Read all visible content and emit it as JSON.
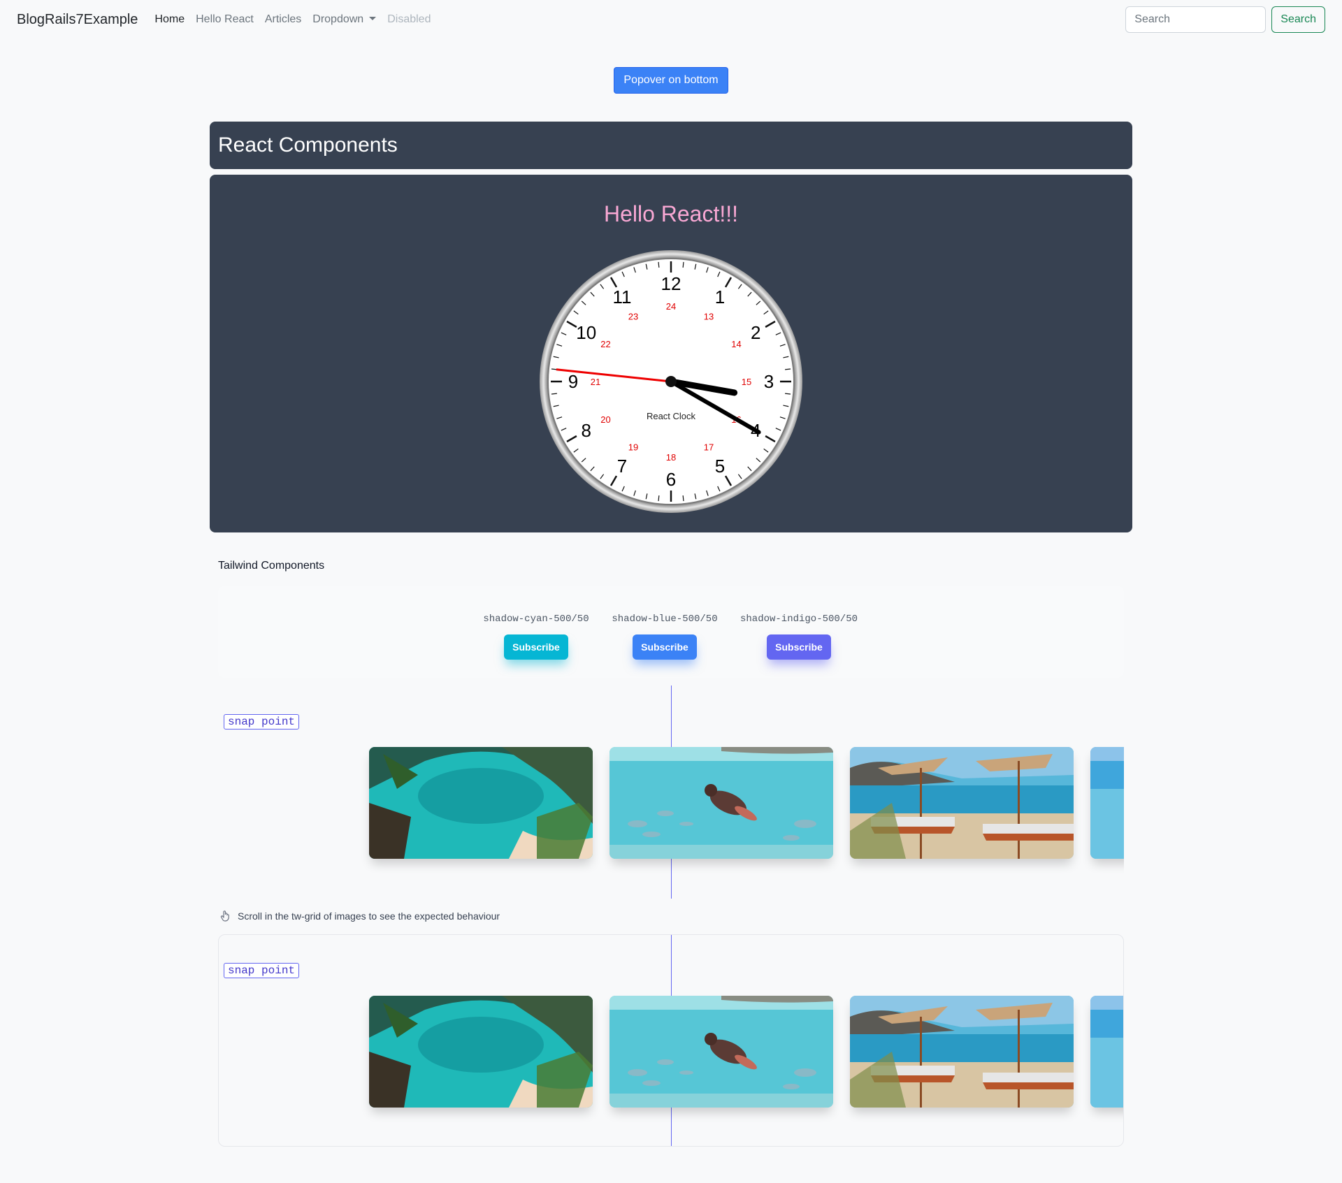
{
  "navbar": {
    "brand": "BlogRails7Example",
    "links": [
      {
        "label": "Home"
      },
      {
        "label": "Hello React"
      },
      {
        "label": "Articles"
      },
      {
        "label": "Dropdown"
      },
      {
        "label": "Disabled"
      }
    ],
    "search_placeholder": "Search",
    "search_button": "Search"
  },
  "popover_button": "Popover on bottom",
  "react": {
    "header": "React Components",
    "hello": "Hello React!!!",
    "clock": {
      "label": "React Clock",
      "hours": [
        "12",
        "1",
        "2",
        "3",
        "4",
        "5",
        "6",
        "7",
        "8",
        "9",
        "10",
        "11"
      ],
      "hours24": [
        "24",
        "13",
        "14",
        "15",
        "16",
        "17",
        "18",
        "19",
        "20",
        "21",
        "22",
        "23"
      ],
      "time": {
        "hour": 3,
        "minute": 20,
        "second": 46
      }
    }
  },
  "tailwind": {
    "title": "Tailwind Components",
    "shadows": [
      {
        "label": "shadow-cyan-500/50",
        "button": "Subscribe",
        "color": "#06b6d4"
      },
      {
        "label": "shadow-blue-500/50",
        "button": "Subscribe",
        "color": "#3b82f6"
      },
      {
        "label": "shadow-indigo-500/50",
        "button": "Subscribe",
        "color": "#6366f1"
      }
    ],
    "snap_label": "snap point",
    "hint": "Scroll in the tw-grid of images to see the expected behaviour",
    "images": [
      "tropical-cove-image",
      "underwater-swimmer-image",
      "beach-loungers-image",
      "ocean-water-image"
    ]
  },
  "colors": {
    "panel": "#374151",
    "hello": "#f9a8d4",
    "snap_line": "#6366f1",
    "primary": "#3b82f6",
    "success": "#198754"
  }
}
